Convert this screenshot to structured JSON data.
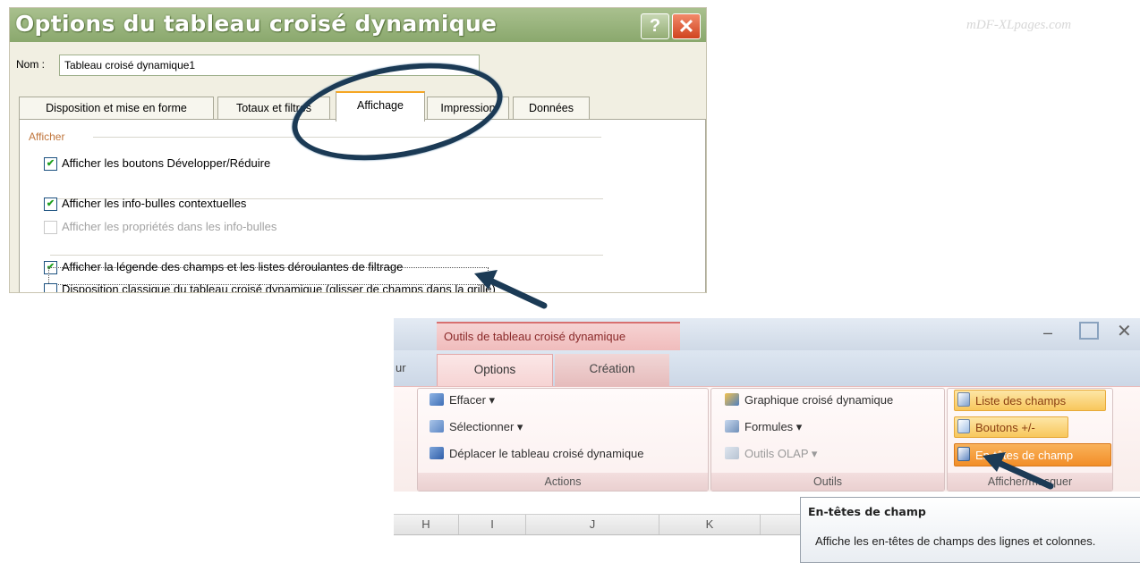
{
  "watermark": "mDF-XLpages.com",
  "dialog": {
    "title": "Options du tableau croisé dynamique",
    "help_glyph": "?",
    "close_glyph": "✕",
    "name_label": "Nom :",
    "name_value": "Tableau croisé dynamique1",
    "tabs": [
      {
        "label": "Disposition et mise en forme",
        "active": false
      },
      {
        "label": "Totaux et filtres",
        "active": false
      },
      {
        "label": "Affichage",
        "active": true
      },
      {
        "label": "Impression",
        "active": false
      },
      {
        "label": "Données",
        "active": false
      }
    ],
    "group_label": "Afficher",
    "options": [
      {
        "label": "Afficher les boutons Développer/Réduire",
        "checked": true,
        "enabled": true
      },
      {
        "label": "Afficher les info-bulles contextuelles",
        "checked": true,
        "enabled": true
      },
      {
        "label": "Afficher les propriétés dans les info-bulles",
        "checked": false,
        "enabled": false
      },
      {
        "label": "Afficher la légende des champs et les listes déroulantes de filtrage",
        "checked": true,
        "enabled": true
      },
      {
        "label": "Disposition classique du tableau croisé dynamique (glisser de champs dans la grille)",
        "checked": false,
        "enabled": true
      }
    ]
  },
  "ribbon": {
    "context_tab": "Outils de tableau croisé dynamique",
    "tab_fragment": "ur",
    "tabs": [
      {
        "label": "Options",
        "active": true
      },
      {
        "label": "Création",
        "active": false
      }
    ],
    "window_min": "–",
    "window_close": "✕",
    "help_glyph": "?",
    "groups": {
      "actions": {
        "title": "Actions",
        "items": [
          {
            "label": "Effacer ▾",
            "enabled": true
          },
          {
            "label": "Sélectionner ▾",
            "enabled": true
          },
          {
            "label": "Déplacer le tableau croisé dynamique",
            "enabled": true
          }
        ]
      },
      "outils": {
        "title": "Outils",
        "items": [
          {
            "label": "Graphique croisé dynamique",
            "enabled": true
          },
          {
            "label": "Formules ▾",
            "enabled": true
          },
          {
            "label": "Outils OLAP ▾",
            "enabled": false
          }
        ]
      },
      "afficher_masquer": {
        "title": "Afficher/masquer",
        "items": [
          {
            "label": "Liste des champs",
            "state": "highlighted"
          },
          {
            "label": "Boutons +/-",
            "state": "highlighted"
          },
          {
            "label": "En-têtes de champ",
            "state": "active"
          }
        ]
      }
    },
    "columns": [
      "H",
      "I",
      "J",
      "K"
    ]
  },
  "tooltip": {
    "title": "En-têtes de champ",
    "description": "Affiche les en-têtes de champs des lignes et colonnes."
  },
  "colors": {
    "title_bar": "#8aa86d",
    "active_tab_accent": "#f5a623",
    "context_tab": "#f0bcbc",
    "highlight": "#f8c75c",
    "highlight_strong": "#f28e28",
    "arrow": "#1b3a55"
  }
}
